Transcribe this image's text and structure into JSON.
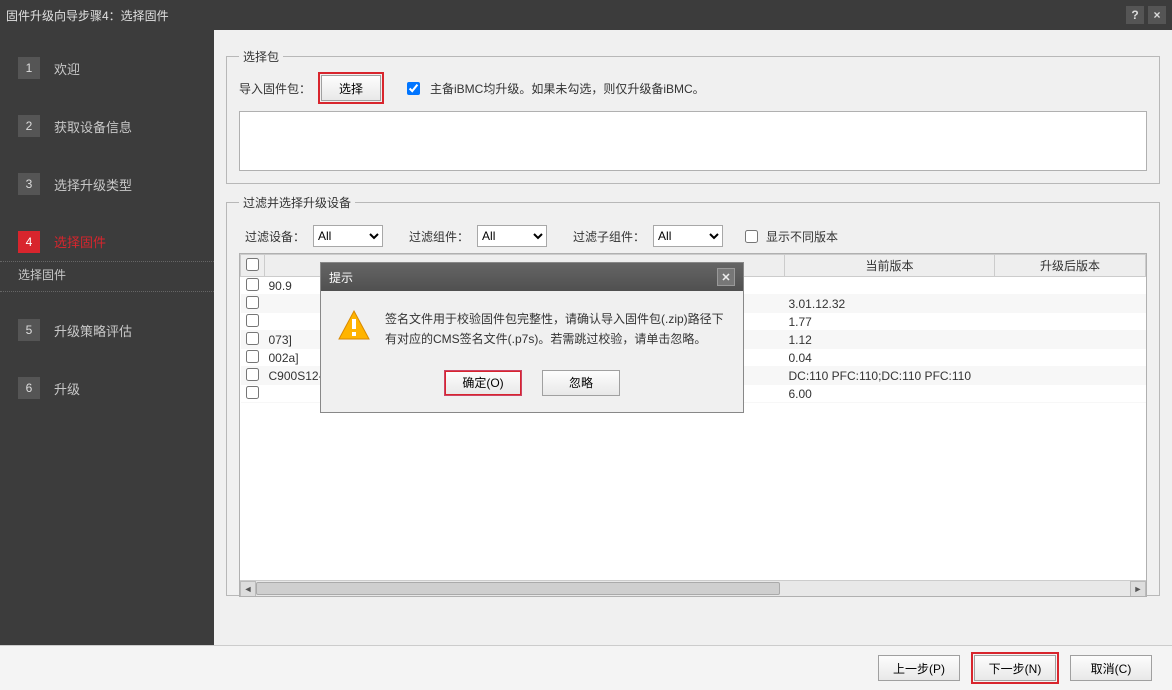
{
  "window": {
    "title": "固件升级向导步骤4：选择固件"
  },
  "sidebar": {
    "steps": [
      {
        "num": "1",
        "label": "欢迎"
      },
      {
        "num": "2",
        "label": "获取设备信息"
      },
      {
        "num": "3",
        "label": "选择升级类型"
      },
      {
        "num": "4",
        "label": "选择固件"
      },
      {
        "num": "5",
        "label": "升级策略评估"
      },
      {
        "num": "6",
        "label": "升级"
      }
    ],
    "substep": "选择固件"
  },
  "select_pkg": {
    "legend": "选择包",
    "import_label": "导入固件包：",
    "choose_btn": "选择",
    "checkbox_label": "主备iBMC均升级。如果未勾选，则仅升级备iBMC。",
    "checked": true
  },
  "filter": {
    "legend": "过滤并选择升级设备",
    "device_label": "过滤设备：",
    "component_label": "过滤组件：",
    "subcomponent_label": "过滤子组件：",
    "all": "All",
    "show_diff_label": "显示不同版本"
  },
  "table": {
    "headers": {
      "current_ver": "当前版本",
      "after_ver": "升级后版本"
    },
    "rows": [
      {
        "col1": "90.9",
        "current": "",
        "after": ""
      },
      {
        "col1": "",
        "current": "3.01.12.32",
        "after": ""
      },
      {
        "col1": "",
        "current": "1.77",
        "after": ""
      },
      {
        "col1": "073]",
        "current": "1.12",
        "after": ""
      },
      {
        "col1": "002a]",
        "current": "0.04",
        "after": ""
      },
      {
        "col1": "C900S12-B1",
        "current": "DC:110 PFC:110;DC:110 PFC:110",
        "after": ""
      },
      {
        "col1": "",
        "current": "6.00",
        "after": ""
      }
    ]
  },
  "dialog": {
    "title": "提示",
    "message": "签名文件用于校验固件包完整性，请确认导入固件包(.zip)路径下有对应的CMS签名文件(.p7s)。若需跳过校验，请单击忽略。",
    "ok": "确定(O)",
    "ignore": "忽略"
  },
  "footer": {
    "prev": "上一步(P)",
    "next": "下一步(N)",
    "cancel": "取消(C)"
  }
}
